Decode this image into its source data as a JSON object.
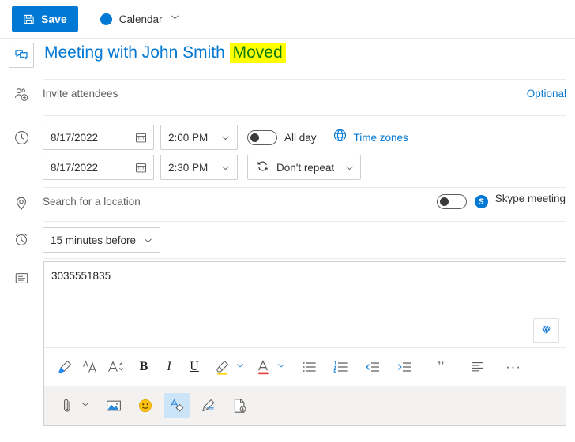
{
  "command_bar": {
    "save_label": "Save",
    "save_icon": "save-floppy-icon",
    "calendar_label": "Calendar",
    "calendar_color": "#0078d4",
    "calendar_chevron": "chevron-down-icon"
  },
  "title": {
    "icon": "meeting-event-icon",
    "text_plain": "Meeting with John Smith ",
    "text_highlight": "Moved",
    "text_color": "#0078d4",
    "highlight_bg": "#ffff00",
    "highlight_color": "#107c10"
  },
  "attendees": {
    "icon": "add-people-icon",
    "placeholder": "Invite attendees",
    "optional_label": "Optional"
  },
  "datetime": {
    "icon": "clock-icon",
    "start_date": "8/17/2022",
    "start_time": "2:00 PM",
    "end_date": "8/17/2022",
    "end_time": "2:30 PM",
    "calendar_icon": "calendar-icon",
    "chevron": "chevron-down-icon",
    "all_day_label": "All day",
    "all_day_on": false,
    "time_zones_label": "Time zones",
    "time_zones_icon": "globe-icon",
    "repeat_label": "Don't repeat",
    "repeat_icon": "repeat-icon"
  },
  "location": {
    "icon": "location-pin-icon",
    "placeholder": "Search for a location",
    "skype_label": "Skype meeting",
    "skype_icon": "skype-icon",
    "skype_badge_text": "S",
    "skype_on": false
  },
  "reminder": {
    "icon": "alarm-clock-icon",
    "value": "15 minutes before"
  },
  "body": {
    "icon": "description-icon",
    "text": "3035551835",
    "gem_icon": "diamond-gem-icon"
  },
  "format_toolbar": {
    "items": [
      {
        "name": "format-painter-icon",
        "label": "Format painter"
      },
      {
        "name": "font-family-icon",
        "label": "Font"
      },
      {
        "name": "font-size-icon",
        "label": "Font size"
      },
      {
        "name": "bold-icon",
        "label": "B"
      },
      {
        "name": "italic-icon",
        "label": "I"
      },
      {
        "name": "underline-icon",
        "label": "U"
      },
      {
        "name": "highlight-color-icon",
        "label": "Highlight"
      },
      {
        "name": "font-color-icon",
        "label": "Font color"
      },
      {
        "name": "bulleted-list-icon",
        "label": "Bullets"
      },
      {
        "name": "numbered-list-icon",
        "label": "Numbering"
      },
      {
        "name": "decrease-indent-icon",
        "label": "Decrease indent"
      },
      {
        "name": "increase-indent-icon",
        "label": "Increase indent"
      },
      {
        "name": "quote-icon",
        "label": "Quote"
      },
      {
        "name": "align-icon",
        "label": "Align"
      },
      {
        "name": "more-options-icon",
        "label": "More options"
      }
    ],
    "more_glyph": "···"
  },
  "action_toolbar": {
    "items": [
      {
        "name": "attach-file-icon",
        "label": "Attach",
        "selected": false
      },
      {
        "name": "insert-picture-icon",
        "label": "Insert picture",
        "selected": false
      },
      {
        "name": "emoji-icon",
        "label": "Emoji",
        "selected": false
      },
      {
        "name": "sensitivity-icon",
        "label": "Sensitivity",
        "selected": true
      },
      {
        "name": "signature-icon",
        "label": "Signature",
        "selected": false
      },
      {
        "name": "insert-template-icon",
        "label": "My templates",
        "selected": false
      }
    ]
  }
}
